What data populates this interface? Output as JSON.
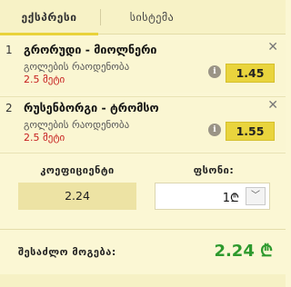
{
  "tabs": [
    {
      "label": "ექსპრესი",
      "active": true
    },
    {
      "label": "სისტემა",
      "active": false
    }
  ],
  "bets": [
    {
      "number": "1",
      "match": "გრორუდი - მიოლნერი",
      "market": "გოლების რაოდენობა",
      "pick": "2.5 მეტი",
      "odd": "1.45"
    },
    {
      "number": "2",
      "match": "რუსენბორგი - ტრომსო",
      "market": "გოლების რაოდენობა",
      "pick": "2.5 მეტი",
      "odd": "1.55"
    }
  ],
  "icons": {
    "close": "close-icon",
    "info": "info-icon",
    "dropdown": "chevron-down-icon"
  },
  "summary": {
    "coefficient_label": "კოეფიციენტი",
    "coefficient_value": "2.24",
    "stake_label": "ფსონი:",
    "stake_value": "1₾",
    "possible_win_label": "შესაძლო მოგება:",
    "possible_win_value": "2.24 ₾"
  },
  "colors": {
    "accent": "#e9d43d",
    "win": "#2e9a2e",
    "pick": "#c61d1d",
    "background": "#fbf7d4"
  }
}
